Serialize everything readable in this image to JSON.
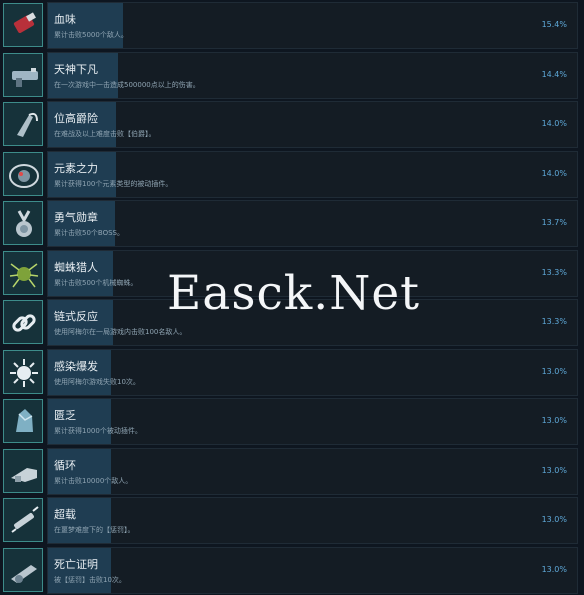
{
  "achievements": [
    {
      "title": "血味",
      "desc": "累计击败5000个敌人。",
      "percent": "15.4%",
      "fill": 0.154,
      "icon": "blood-vial-icon"
    },
    {
      "title": "天神下凡",
      "desc": "在一次游戏中一击造成500000点以上的伤害。",
      "percent": "14.4%",
      "fill": 0.144,
      "icon": "heavy-gun-icon"
    },
    {
      "title": "位高爵险",
      "desc": "在难战及以上难度击败【伯爵】。",
      "percent": "14.0%",
      "fill": 0.14,
      "icon": "claw-weapon-icon"
    },
    {
      "title": "元素之力",
      "desc": "累计获得100个元素类型的被动插件。",
      "percent": "14.0%",
      "fill": 0.14,
      "icon": "element-orb-icon"
    },
    {
      "title": "勇气勋章",
      "desc": "累计击败50个BOSS。",
      "percent": "13.7%",
      "fill": 0.137,
      "icon": "medal-icon"
    },
    {
      "title": "蜘蛛猎人",
      "desc": "累计击败500个机械蜘蛛。",
      "percent": "13.3%",
      "fill": 0.133,
      "icon": "spider-icon"
    },
    {
      "title": "链式反应",
      "desc": "使用阿梅尔在一局游戏内击败100名敌人。",
      "percent": "13.3%",
      "fill": 0.133,
      "icon": "chain-link-icon"
    },
    {
      "title": "感染爆发",
      "desc": "使用阿梅尔游戏失败10次。",
      "percent": "13.0%",
      "fill": 0.13,
      "icon": "virus-icon"
    },
    {
      "title": "匮乏",
      "desc": "累计获得1000个被动插件。",
      "percent": "13.0%",
      "fill": 0.13,
      "icon": "crystal-icon"
    },
    {
      "title": "循环",
      "desc": "累计击败10000个敌人。",
      "percent": "13.0%",
      "fill": 0.13,
      "icon": "gauntlet-icon"
    },
    {
      "title": "超载",
      "desc": "在噩梦难度下的【惩罚】。",
      "percent": "13.0%",
      "fill": 0.13,
      "icon": "syringe-icon"
    },
    {
      "title": "死亡证明",
      "desc": "被【惩罚】击败10次。",
      "percent": "13.0%",
      "fill": 0.13,
      "icon": "cannon-icon"
    }
  ],
  "watermark": "Easck.Net",
  "colors": {
    "background": "#0e1620",
    "bar": "#141c24",
    "bar_fill": "#1f3d52",
    "icon_bg": "#16323a",
    "icon_border": "#3d8c8a",
    "percent": "#5ea8d8"
  }
}
